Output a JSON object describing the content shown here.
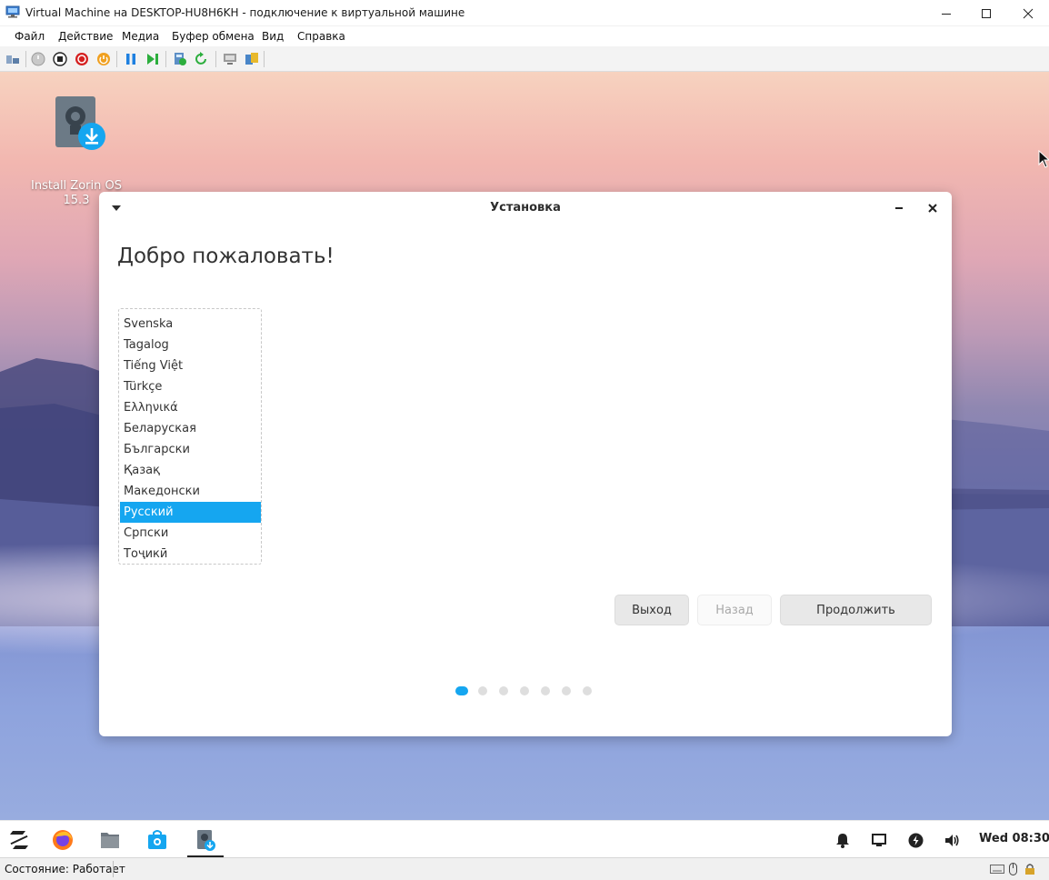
{
  "host_window": {
    "title": "Virtual Machine на DESKTOP-HU8H6KH - подключение к виртуальной машине",
    "menu": [
      "Файл",
      "Действие",
      "Медиа",
      "Буфер обмена",
      "Вид",
      "Справка"
    ],
    "toolbar_icons": [
      "ctrl-alt-del-icon",
      "start-icon",
      "turn-off-icon",
      "shutdown-icon",
      "save-icon",
      "pause-icon",
      "reset-icon",
      "checkpoint-icon",
      "revert-icon",
      "enhanced-session-icon",
      "share-icon"
    ],
    "status": "Состояние: Работает"
  },
  "desktop": {
    "icon_label": "Install Zorin OS 15.3"
  },
  "installer": {
    "title": "Установка",
    "heading": "Добро пожаловать!",
    "languages": [
      "Svenska",
      "Tagalog",
      "Tiếng Việt",
      "Türkçe",
      "Ελληνικά",
      "Беларуская",
      "Български",
      "Қазақ",
      "Македонски",
      "Русский",
      "Српски",
      "Тоҷикӣ"
    ],
    "selected_language": "Русский",
    "buttons": {
      "quit": "Выход",
      "back": "Назад",
      "continue": "Продолжить"
    },
    "steps_total": 7,
    "step_current": 1,
    "accent_color": "#15a6f0"
  },
  "taskbar": {
    "apps": [
      "zorin-menu-icon",
      "firefox-icon",
      "files-icon",
      "software-store-icon",
      "installer-icon"
    ],
    "tray": [
      "notifications-icon",
      "display-icon",
      "power-icon",
      "volume-icon"
    ],
    "clock": "Wed 08:30"
  }
}
